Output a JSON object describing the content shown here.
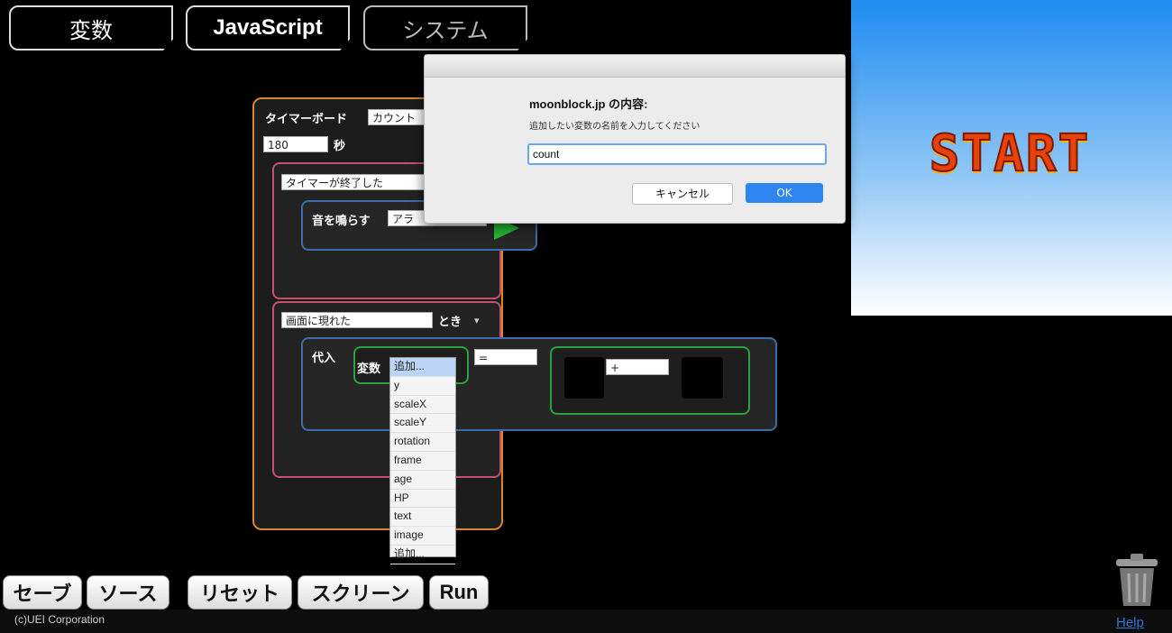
{
  "tabs": [
    {
      "label": "変数"
    },
    {
      "label": "JavaScript"
    },
    {
      "label": "システム"
    }
  ],
  "stage": {
    "start_text": "START"
  },
  "blocks": {
    "timer_label": "タイマーボード",
    "timer_mode": "カウント",
    "timer_seconds": "180",
    "seconds_unit": "秒",
    "event_timer_end": "タイマーが終了した",
    "play_sound": "音を鳴らす",
    "sound_value": "アラ",
    "event_screen": "画面に現れた",
    "when": "とき",
    "assign": "代入",
    "variable": "変数",
    "operator_assign": "=",
    "operator_plus": "+"
  },
  "dialog": {
    "title": "moonblock.jp の内容:",
    "message": "追加したい変数の名前を入力してください",
    "input_value": "count",
    "cancel_label": "キャンセル",
    "ok_label": "OK"
  },
  "dropdown": {
    "items": [
      "追加...",
      "y",
      "scaleX",
      "scaleY",
      "rotation",
      "frame",
      "age",
      "HP",
      "text",
      "image",
      "追加..."
    ]
  },
  "bottom_buttons": {
    "save": "セーブ",
    "source": "ソース",
    "reset": "リセット",
    "screen": "スクリーン",
    "run": "Run"
  },
  "footer": {
    "copyright": "(c)UEI Corporation",
    "help": "Help"
  },
  "colors": {
    "accent_orange": "#d7862d",
    "accent_pink": "#c74f70",
    "accent_blue": "#3b6ea8",
    "accent_green": "#2aa13a",
    "ok_button": "#2f86f0"
  }
}
